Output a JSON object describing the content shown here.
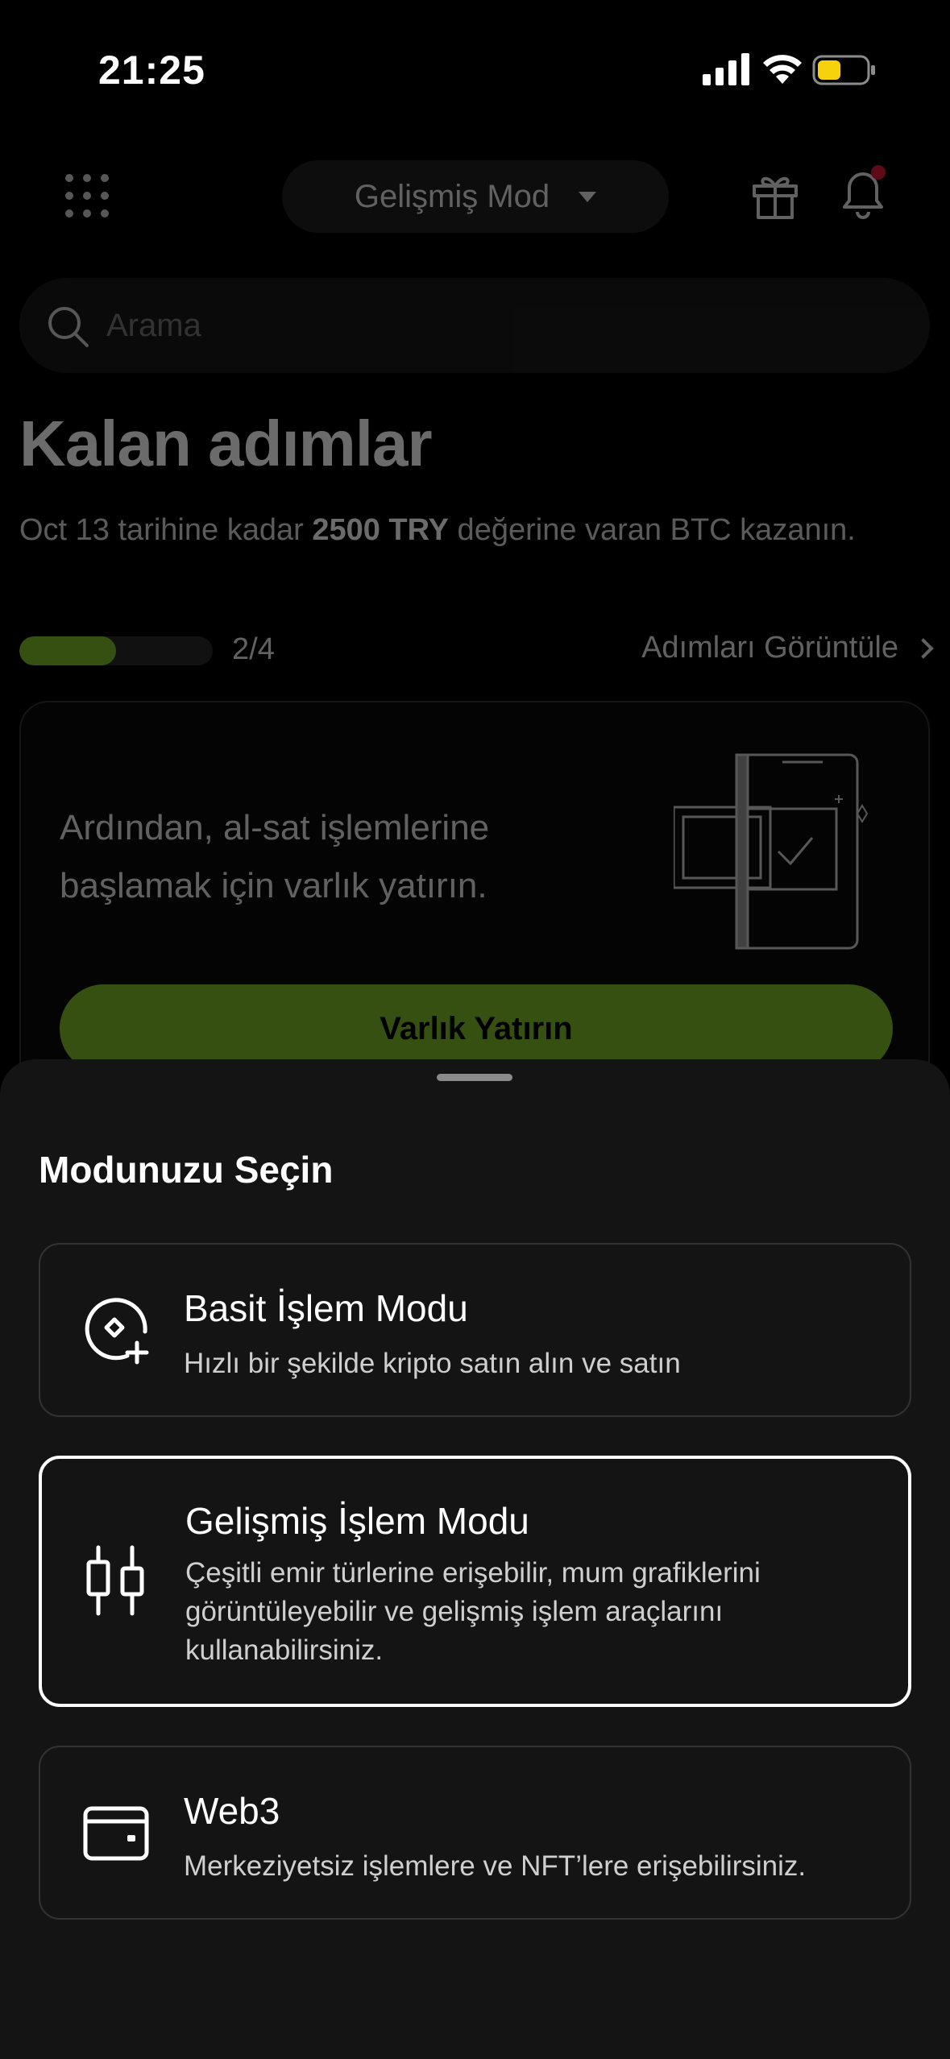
{
  "status_bar": {
    "time": "21:25",
    "icons": [
      "signal-icon",
      "wifi-icon",
      "battery-icon"
    ],
    "battery_color": "#F5D20C"
  },
  "header": {
    "menu_icon": "grid-menu-icon",
    "mode_label": "Gelişmiş Mod",
    "gift_icon": "gift-icon",
    "bell_icon": "bell-icon",
    "notification_dot_color": "#E0183C"
  },
  "search": {
    "placeholder": "Arama",
    "value": ""
  },
  "steps": {
    "title": "Kalan adımlar",
    "desc_before": "Oct 13 tarihine kadar ",
    "desc_bold": "2500 TRY",
    "desc_after": " değerine varan BTC kazanın.",
    "progress_fraction": 0.5,
    "progress_label": "2/4",
    "view_link": "Adımları Görüntüle"
  },
  "deposit_card": {
    "text": "Ardından, al-sat işlemlerine başlamak için varlık yatırın.",
    "button_label": "Varlık Yatırın",
    "accent_color": "#7FBF2A"
  },
  "sheet": {
    "title": "Modunuzu Seçin",
    "options": [
      {
        "icon": "simple-trade-icon",
        "title": "Basit İşlem Modu",
        "desc": "Hızlı bir şekilde kripto satın alın ve satın",
        "selected": false
      },
      {
        "icon": "candlestick-icon",
        "title": "Gelişmiş İşlem Modu",
        "desc": "Çeşitli emir türlerine erişebilir, mum grafiklerini görüntüleyebilir ve gelişmiş işlem araçlarını kullanabilirsiniz.",
        "selected": true
      },
      {
        "icon": "wallet-icon",
        "title": "Web3",
        "desc": "Merkeziyetsiz işlemlere ve NFT’lere erişebilirsiniz.",
        "selected": false
      }
    ]
  }
}
